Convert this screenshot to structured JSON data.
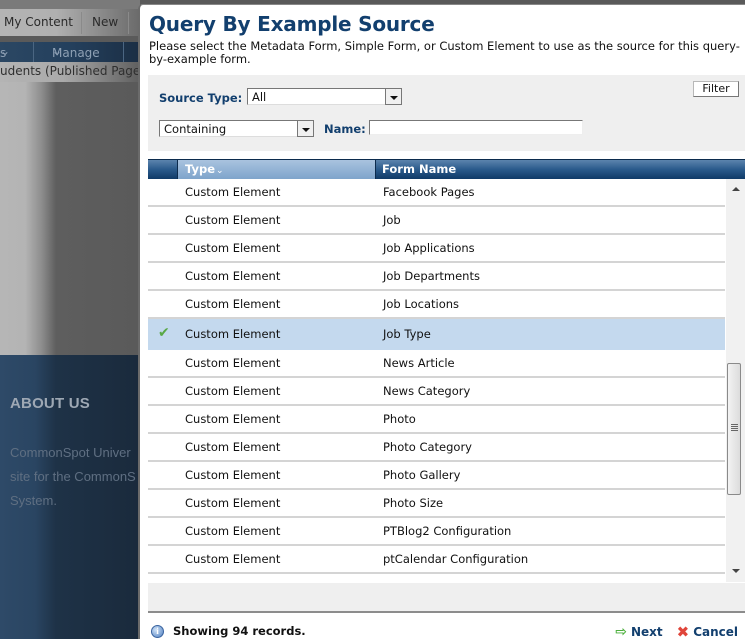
{
  "background_page": {
    "top_nav": [
      "My Content",
      "New"
    ],
    "second_nav": [
      "s",
      "Manage"
    ],
    "breadcrumb": "udents (Published Page -",
    "footer": {
      "heading": "ABOUT US",
      "lines": [
        "CommonSpot Univer",
        "site for the CommonS",
        "System."
      ]
    }
  },
  "dialog": {
    "title": "Query By Example Source",
    "description": "Please select the Metadata Form, Simple Form, or Custom Element to use as the source for this query-by-example form.",
    "filter_button": "Filter",
    "source_type": {
      "label": "Source Type:",
      "value": "All"
    },
    "match_mode": {
      "value": "Containing"
    },
    "name_filter": {
      "label": "Name:",
      "value": ""
    },
    "grid": {
      "columns": [
        {
          "label": "Type",
          "sort_indicator": "⌄"
        },
        {
          "label": "Form Name"
        }
      ],
      "rows": [
        {
          "type": "Custom Element",
          "name": "Facebook Pages",
          "selected": false
        },
        {
          "type": "Custom Element",
          "name": "Job",
          "selected": false
        },
        {
          "type": "Custom Element",
          "name": "Job Applications",
          "selected": false
        },
        {
          "type": "Custom Element",
          "name": "Job Departments",
          "selected": false
        },
        {
          "type": "Custom Element",
          "name": "Job Locations",
          "selected": false
        },
        {
          "type": "Custom Element",
          "name": "Job Type",
          "selected": true
        },
        {
          "type": "Custom Element",
          "name": "News Article",
          "selected": false
        },
        {
          "type": "Custom Element",
          "name": "News Category",
          "selected": false
        },
        {
          "type": "Custom Element",
          "name": "Photo",
          "selected": false
        },
        {
          "type": "Custom Element",
          "name": "Photo Category",
          "selected": false
        },
        {
          "type": "Custom Element",
          "name": "Photo Gallery",
          "selected": false
        },
        {
          "type": "Custom Element",
          "name": "Photo Size",
          "selected": false
        },
        {
          "type": "Custom Element",
          "name": "PTBlog2 Configuration",
          "selected": false
        },
        {
          "type": "Custom Element",
          "name": "ptCalendar Configuration",
          "selected": false
        }
      ],
      "selected_icon": "checkmark-icon"
    },
    "status": {
      "icon": "info-icon",
      "text": "Showing 94 records."
    },
    "actions": {
      "next": {
        "label": "Next",
        "icon": "arrow-right-icon"
      },
      "cancel": {
        "label": "Cancel",
        "icon": "x-icon"
      }
    }
  },
  "colors": {
    "title": "#123f6e",
    "header_blue": "#0f3a67",
    "selected_row": "#c4d9ee",
    "check_green": "#59a845",
    "cancel_red": "#e0453a"
  }
}
